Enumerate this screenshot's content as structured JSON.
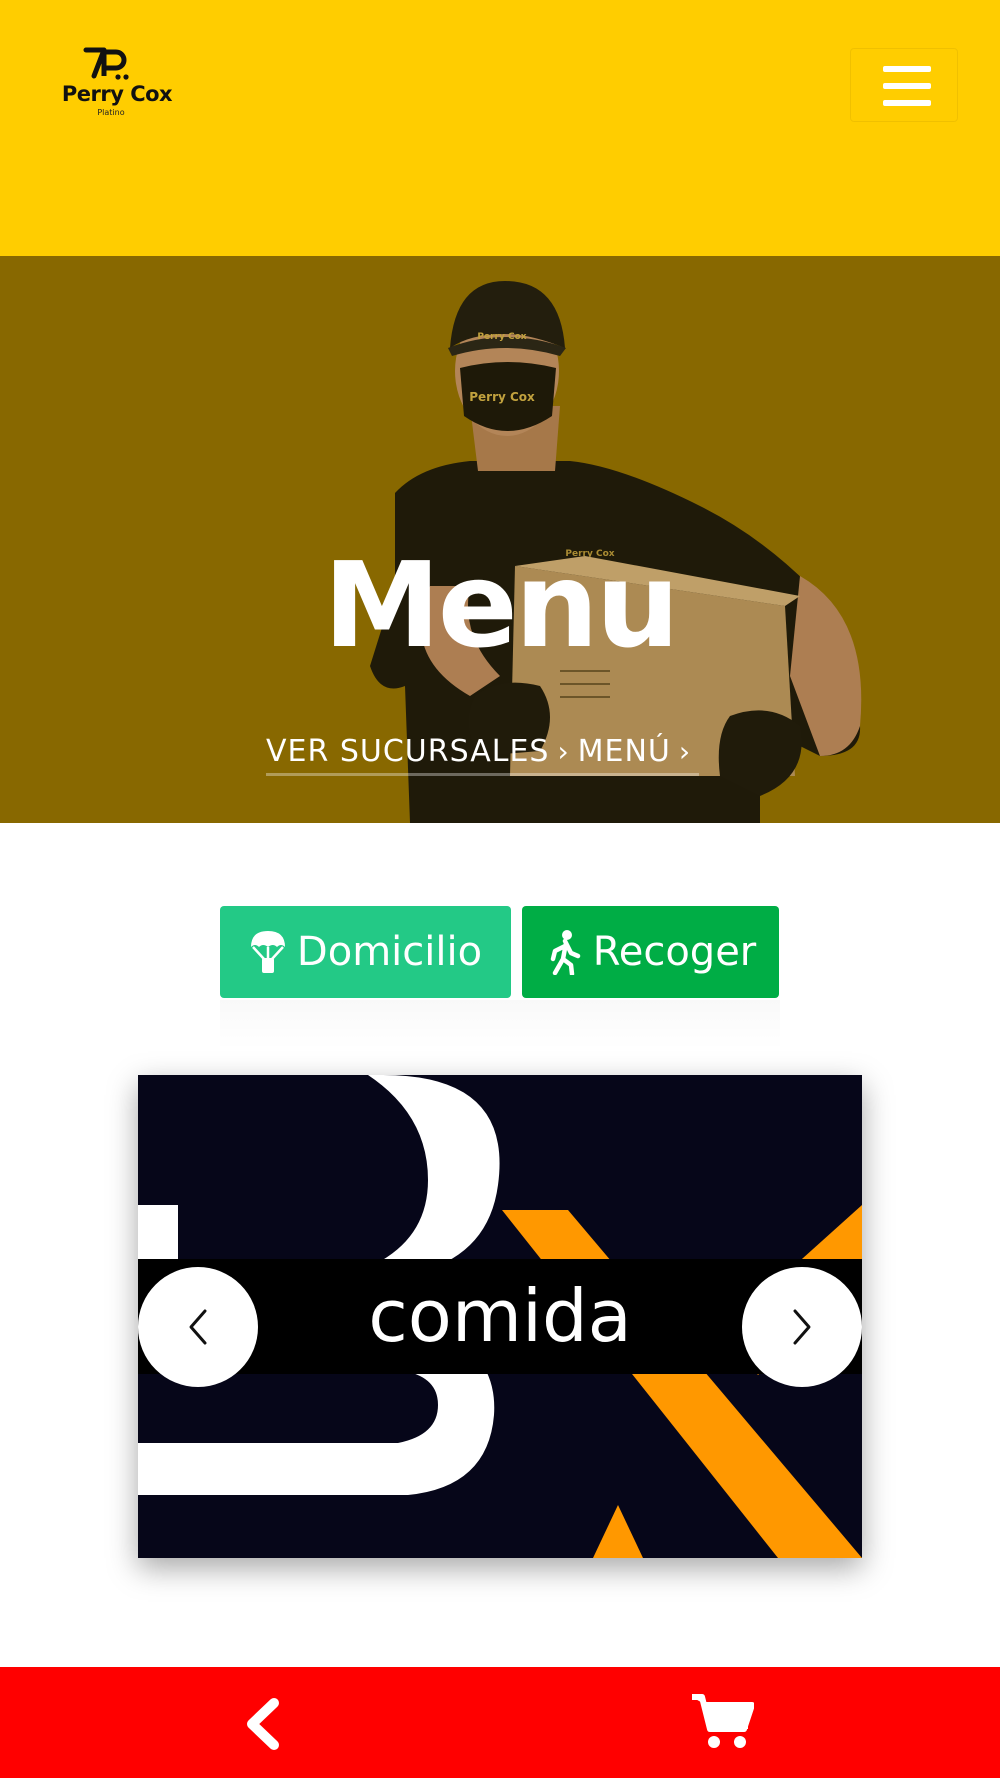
{
  "header": {
    "logo_name": "Perry Cox",
    "logo_sub": "Platino"
  },
  "hero": {
    "title": "Menu",
    "breadcrumb": [
      {
        "label": "VER SUCURSALES"
      },
      {
        "label": "MENÚ"
      }
    ]
  },
  "order_type": {
    "delivery_label": "Domicilio",
    "pickup_label": "Recoger"
  },
  "carousel": {
    "caption": "comida"
  },
  "icons": {
    "menu": "hamburger-icon",
    "delivery": "parachute-icon",
    "pickup": "walking-icon",
    "prev": "chevron-left-icon",
    "next": "chevron-right-icon",
    "back": "chevron-left-icon",
    "cart": "cart-icon"
  },
  "colors": {
    "header_bg": "#ffcd00",
    "hero_overlay": "#8b6b00",
    "delivery_button": "#23c986",
    "pickup_button": "#00ad45",
    "bottom_bar": "#ff0000",
    "carousel_accent": "#ff9800"
  }
}
